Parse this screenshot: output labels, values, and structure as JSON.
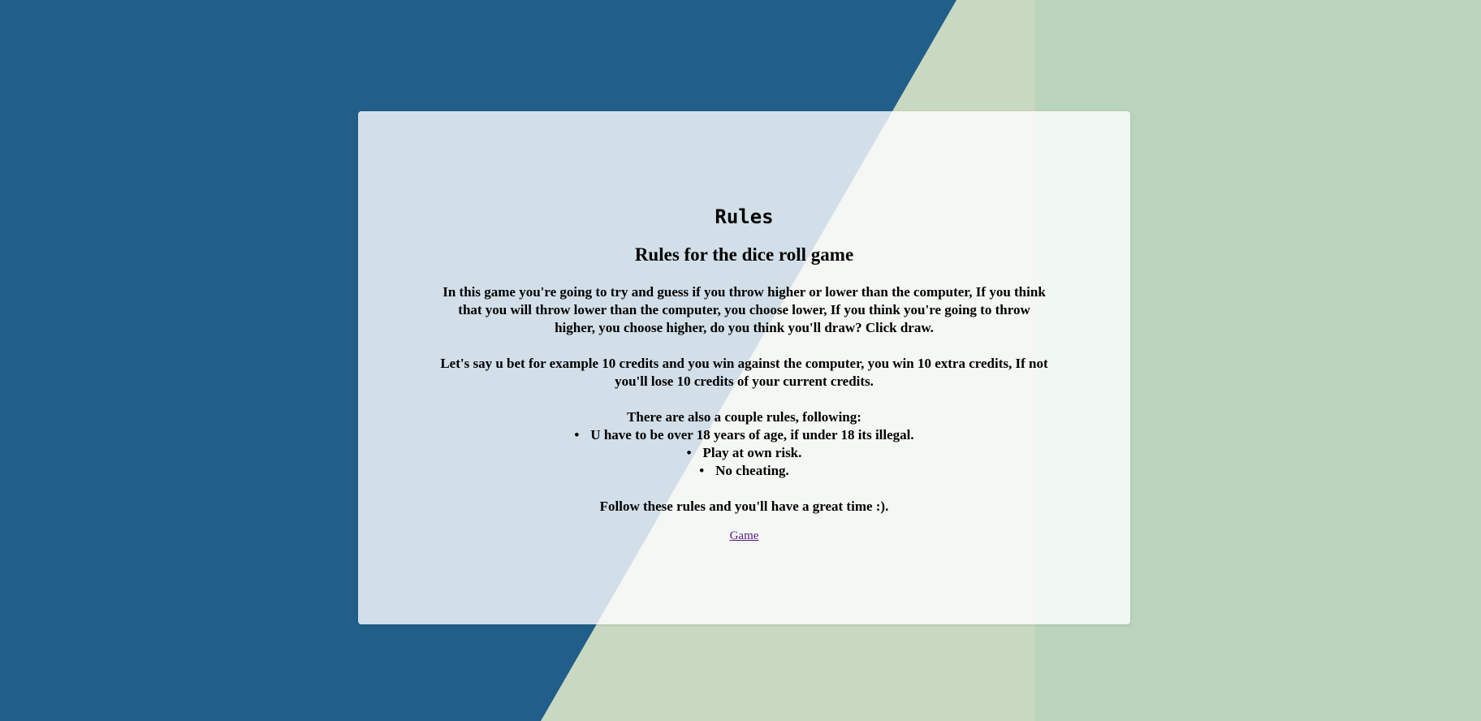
{
  "page": {
    "title": "Rules",
    "subtitle": "Rules for the dice roll game"
  },
  "content": {
    "paragraph1": "In this game you're going to try and guess if you throw higher or lower than the computer, If you think that you will throw lower than the computer, you choose lower, If you think you're going to throw higher, you choose higher, do you think you'll draw? Click draw.",
    "paragraph2": "Let's say u bet for example 10 credits and you win against the computer, you win 10 extra credits, If not you'll lose 10 credits of your current credits.",
    "rules_intro": "There are also a couple rules, following:",
    "rules": [
      "U have to be over 18 years of age, if under 18 its illegal.",
      "Play at own risk.",
      "No cheating."
    ],
    "closing": "Follow these rules and you'll have a great time :)."
  },
  "links": {
    "game": "Game"
  },
  "colors": {
    "background_blue": "#215e8a",
    "background_green": "#b9d4ba",
    "background_band": "#c9d8c0",
    "link_visited": "#551a8b"
  }
}
